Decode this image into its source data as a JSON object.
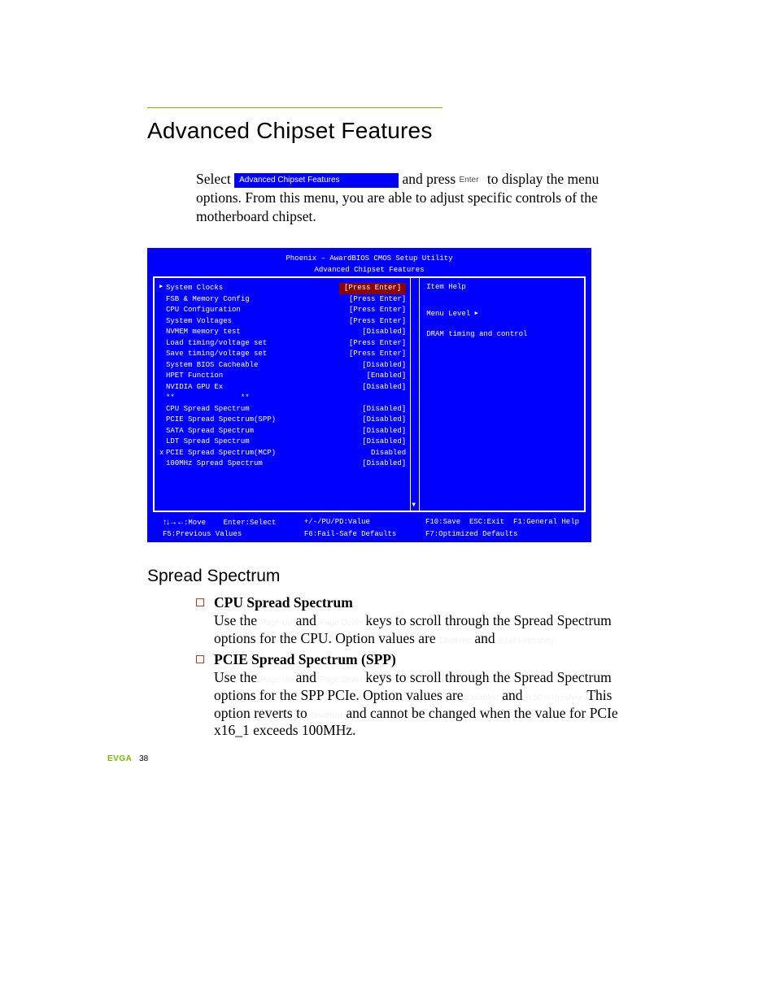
{
  "page": {
    "title": "Advanced Chipset Features",
    "intro_pre": "Select ",
    "intro_pill": "Advanced Chipset Features",
    "intro_mid": " and press ",
    "intro_key": "Enter",
    "intro_post": " to display the menu options. From this menu, you are able to adjust specific controls of the motherboard chipset."
  },
  "bios": {
    "header_line1": "Phoenix – AwardBIOS CMOS Setup Utility",
    "header_line2": "Advanced Chipset Features",
    "help_head": "Item Help",
    "help_level": "Menu Level   ",
    "help_body": "DRAM timing and control",
    "rows": [
      {
        "arrow": "▶",
        "label": "System Clocks",
        "value": "[Press Enter]",
        "hl": true
      },
      {
        "arrow": " ",
        "label": "FSB & Memory Config",
        "value": "[Press Enter]"
      },
      {
        "arrow": " ",
        "label": "CPU Configuration",
        "value": "[Press Enter]"
      },
      {
        "arrow": " ",
        "label": "System Voltages",
        "value": "[Press Enter]"
      },
      {
        "arrow": " ",
        "label": "NVMEM memory test",
        "value": "[Disabled]"
      },
      {
        "arrow": " ",
        "label": "Load timing/voltage set",
        "value": "[Press Enter]"
      },
      {
        "arrow": " ",
        "label": "Save timing/voltage set",
        "value": "[Press Enter]"
      },
      {
        "arrow": " ",
        "label": "System BIOS Cacheable",
        "value": "[Disabled]"
      },
      {
        "arrow": " ",
        "label": "HPET Function",
        "value": "[Enabled]"
      },
      {
        "arrow": " ",
        "label": "NVIDIA GPU Ex",
        "value": "[Disabled]"
      },
      {
        "arrow": " ",
        "label": "**               **",
        "value": ""
      },
      {
        "arrow": " ",
        "label": "CPU Spread Spectrum",
        "value": "[Disabled]"
      },
      {
        "arrow": " ",
        "label": "PCIE Spread Spectrum(SPP)",
        "value": "[Disabled]"
      },
      {
        "arrow": " ",
        "label": "SATA Spread Spectrum",
        "value": "[Disabled]"
      },
      {
        "arrow": " ",
        "label": "LDT Spread Spectrum",
        "value": "[Disabled]"
      },
      {
        "arrow": "x",
        "label": "PCIE Spread Spectrum(MCP)",
        "value": "Disabled"
      },
      {
        "arrow": " ",
        "label": "100MHz Spread Spectrum",
        "value": "[Disabled]"
      }
    ],
    "footer": {
      "c1r1_nav": "↑↓→←",
      "c1r1": ":Move    Enter:Select",
      "c2r1": "+/-/PU/PD:Value",
      "c3r1": "F10:Save  ESC:Exit  F1:General Help",
      "c1r2": "F5:Previous Values",
      "c2r2": "F6:Fail-Safe Defaults",
      "c3r2": "F7:Optimized Defaults"
    }
  },
  "spread": {
    "heading": "Spread Spectrum",
    "items": [
      {
        "title": "CPU Spread Spectrum",
        "pre": "Use the ",
        "k1": "Page Up",
        "mid1": " and ",
        "k2": "Page Down",
        "mid2": " keys to scroll through the Spread Spectrum options for the CPU. Option values are ",
        "v1": "Disabled",
        "mid3": " and ",
        "v2": "0.50% Hershey.",
        "tail": ""
      },
      {
        "title": "PCIE Spread Spectrum (SPP)",
        "pre": "Use the ",
        "k1": "Page Up",
        "mid1": " and ",
        "k2": "Page Down",
        "mid2": " keys to scroll through the Spread Spectrum options for the SPP PCIe. Option values are ",
        "v1": "Disabled",
        "mid3": " and ",
        "v2": "0.50% Hershey.",
        "tail_pre": " This option reverts to ",
        "tail_v": "Disabled",
        "tail_post": " and cannot be changed when the value for PCIe x16_1 exceeds 100MHz."
      }
    ]
  },
  "footer": {
    "brand": "EVGA",
    "page": "38"
  }
}
